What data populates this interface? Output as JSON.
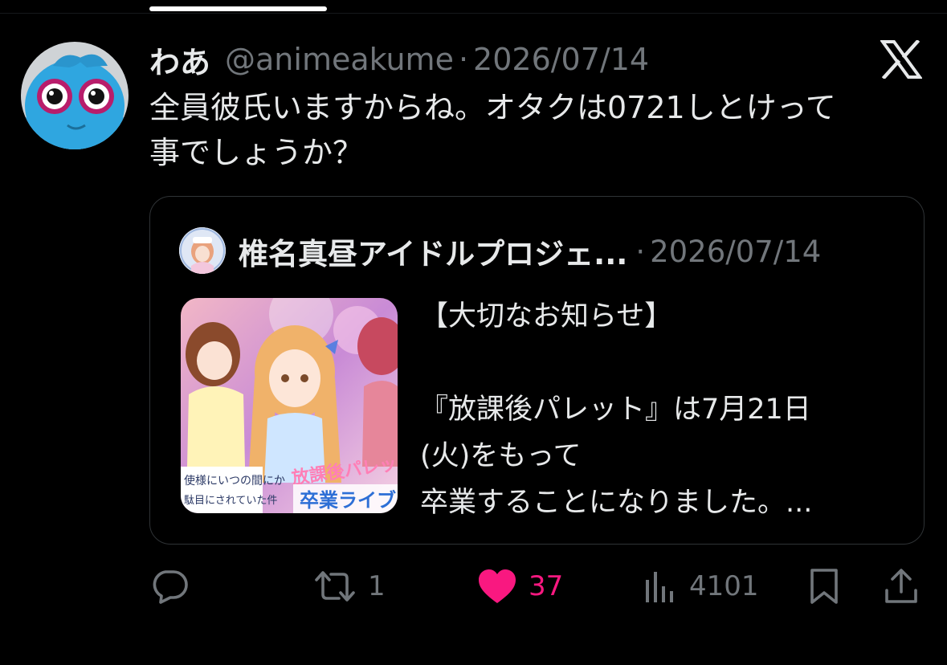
{
  "tweet": {
    "author": {
      "display_name": "わあ",
      "handle": "@animeakume",
      "avatar_icon": "blue-plush-avatar"
    },
    "separator": "·",
    "date": "2026/07/14",
    "text_lines": [
      "全員彼氏いますからね。オタクは0721しとけって",
      "事でしょうか？"
    ],
    "brand_icon": "x-logo-icon"
  },
  "quote": {
    "author": {
      "display_name": "椎名真昼アイドルプロジェ...",
      "avatar_icon": "anime-idol-avatar"
    },
    "separator": "·",
    "date": "2026/07/14",
    "thumbnail": {
      "overlay_text_1": "使様にいつの間にか",
      "overlay_text_2": "駄目にされていた件",
      "overlay_text_3": "放課後パレッ",
      "overlay_text_4": "卒業ライブ"
    },
    "text_lines": [
      "【大切なお知らせ】",
      "",
      "『放課後パレット』は7月21日",
      "(火)をもって",
      "卒業することになりました。..."
    ]
  },
  "actions": {
    "reply": {
      "icon": "reply-icon",
      "count": ""
    },
    "retweet": {
      "icon": "retweet-icon",
      "count": "1"
    },
    "like": {
      "icon": "heart-icon",
      "count": "37",
      "liked": true
    },
    "views": {
      "icon": "views-icon",
      "count": "4101"
    },
    "bookmark": {
      "icon": "bookmark-icon"
    },
    "share": {
      "icon": "share-icon"
    }
  },
  "colors": {
    "background": "#000000",
    "text_primary": "#e7e9ea",
    "text_secondary": "#71767b",
    "like_pink": "#f91880",
    "border": "#2f3336"
  }
}
